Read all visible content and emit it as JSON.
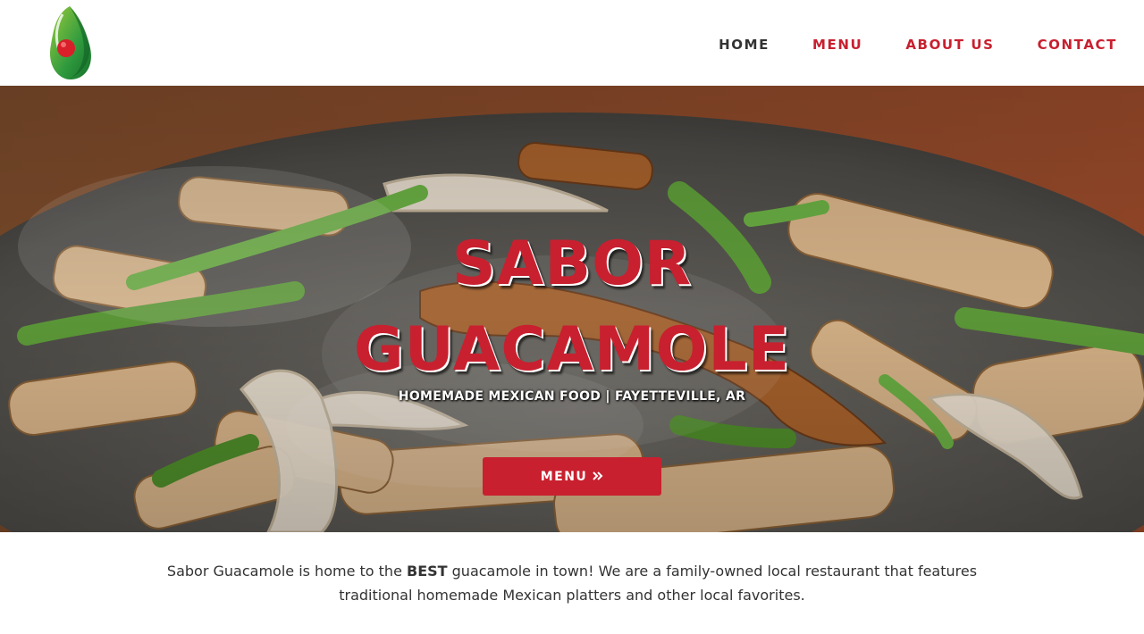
{
  "header": {
    "logo_icon": "avocado-logo-icon",
    "nav": [
      {
        "label": "HOME",
        "active": true
      },
      {
        "label": "MENU",
        "active": false
      },
      {
        "label": "ABOUT US",
        "active": false
      },
      {
        "label": "CONTACT",
        "active": false
      }
    ]
  },
  "hero": {
    "background_image": "sizzling-fajitas-photo",
    "title_line1": "SABOR",
    "title_line2": "GUACAMOLE",
    "subtitle": "HOMEMADE MEXICAN FOOD | FAYETTEVILLE, AR",
    "button_label": "MENU",
    "button_icon": "double-chevron-right-icon"
  },
  "intro": {
    "before": "Sabor Guacamole is home to the ",
    "emphasis": "BEST",
    "after": " guacamole in town! We are a family-owned local restaurant that features traditional homemade Mexican platters and other local favorites."
  },
  "colors": {
    "accent_red": "#c8202f",
    "nav_active": "#333333",
    "text": "#333333"
  }
}
